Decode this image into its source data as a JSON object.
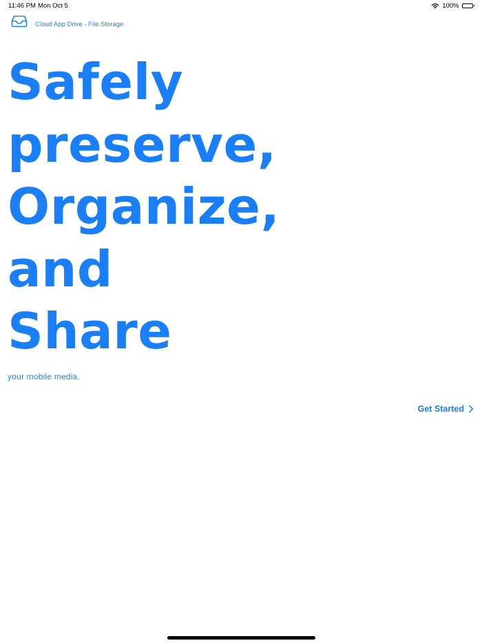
{
  "status_bar": {
    "time": "11:46 PM",
    "date": "Mon Oct 5",
    "battery": "100%",
    "wifi_icon": "wifi-icon",
    "battery_icon": "battery-icon"
  },
  "header": {
    "icon": "tray-icon",
    "title": "Cloud App Drive - File Storage"
  },
  "hero": {
    "lines": [
      "Safely",
      "preserve,",
      "Organize,",
      "and",
      "Share"
    ]
  },
  "subtitle": "your mobile media.",
  "cta": {
    "label": "Get Started",
    "icon": "chevron-right-icon"
  },
  "colors": {
    "accent": "#1a7ff6",
    "link": "#1f86e8"
  }
}
